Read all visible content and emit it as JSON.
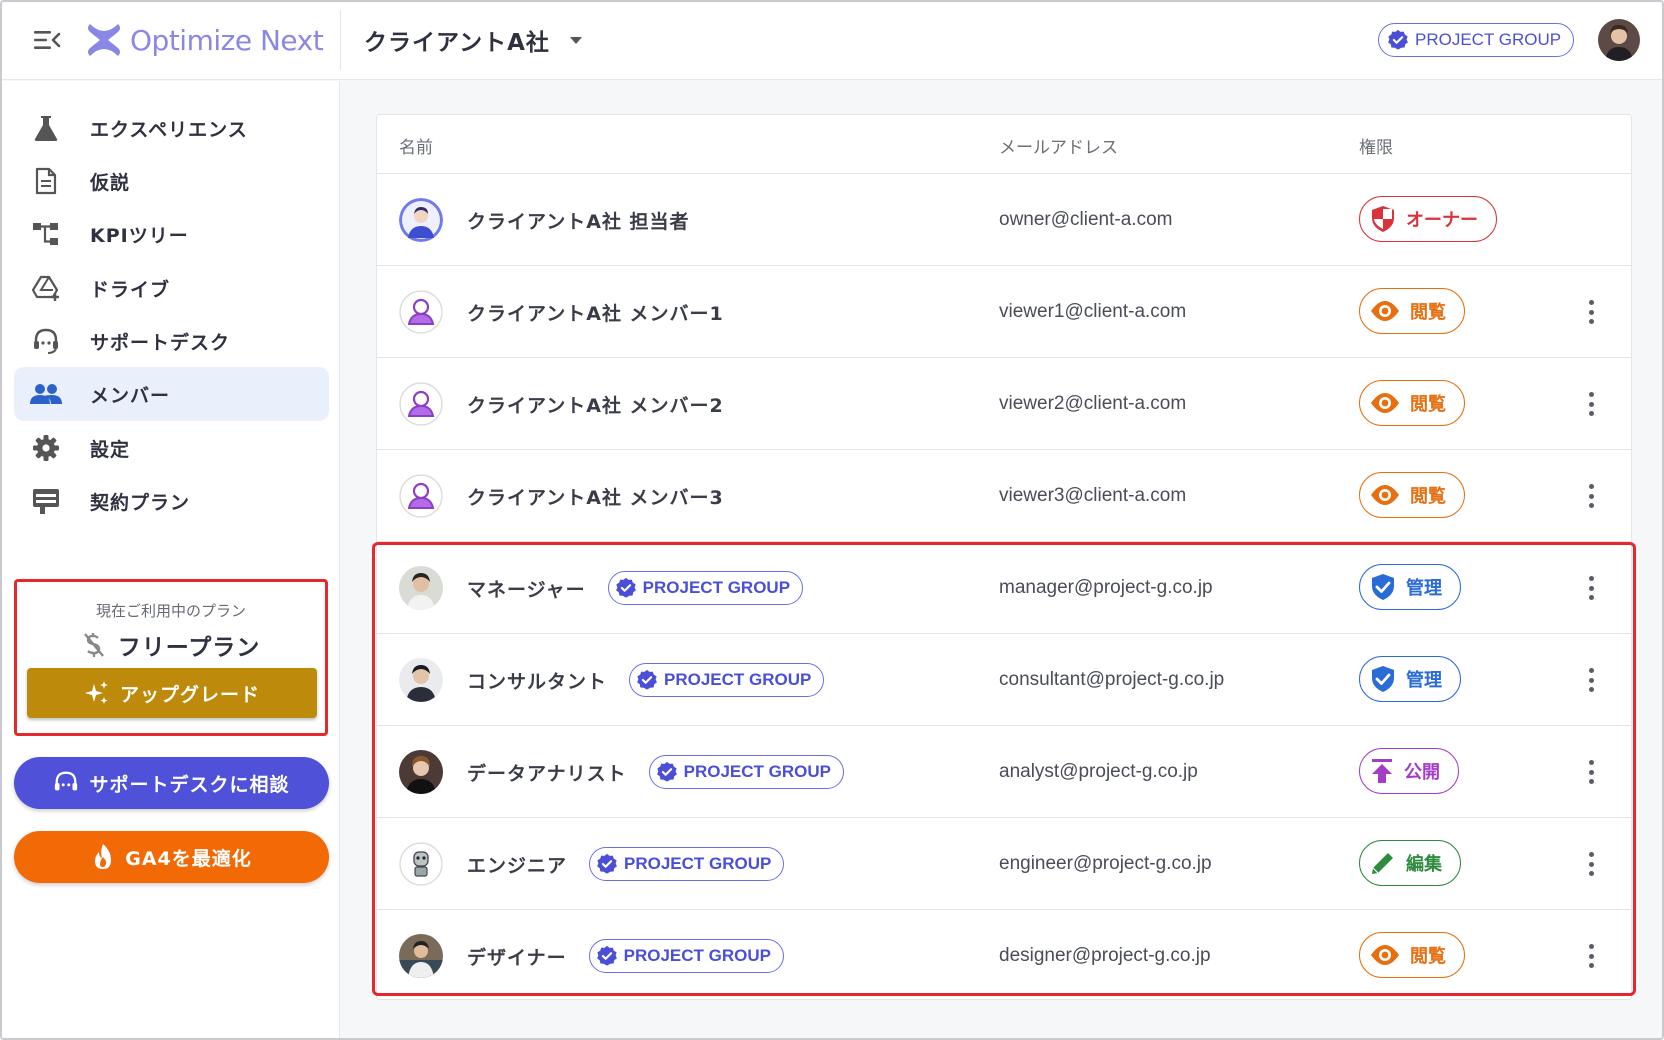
{
  "header": {
    "logo_text": "Optimize Next",
    "client_name": "クライアントA社",
    "group_badge": "PROJECT GROUP"
  },
  "sidebar": {
    "items": [
      {
        "label": "エクスペリエンス",
        "icon": "flask-icon"
      },
      {
        "label": "仮説",
        "icon": "document-icon"
      },
      {
        "label": "KPIツリー",
        "icon": "tree-icon"
      },
      {
        "label": "ドライブ",
        "icon": "drive-icon"
      },
      {
        "label": "サポートデスク",
        "icon": "headset-icon"
      },
      {
        "label": "メンバー",
        "icon": "people-icon",
        "active": true
      },
      {
        "label": "設定",
        "icon": "gear-icon"
      },
      {
        "label": "契約プラン",
        "icon": "plan-icon"
      }
    ],
    "plan": {
      "current_label": "現在ご利用中のプラン",
      "name": "フリープラン",
      "upgrade_label": "アップグレード"
    },
    "support_button": "サポートデスクに相談",
    "ga4_button": "GA4を最適化"
  },
  "table": {
    "headers": {
      "name": "名前",
      "email": "メールアドレス",
      "role": "権限"
    },
    "rows": [
      {
        "name": "クライアントA社 担当者",
        "email": "owner@client-a.com",
        "role": "オーナー",
        "role_type": "owner",
        "badge": ""
      },
      {
        "name": "クライアントA社 メンバー1",
        "email": "viewer1@client-a.com",
        "role": "閲覧",
        "role_type": "view",
        "badge": ""
      },
      {
        "name": "クライアントA社 メンバー2",
        "email": "viewer2@client-a.com",
        "role": "閲覧",
        "role_type": "view",
        "badge": ""
      },
      {
        "name": "クライアントA社 メンバー3",
        "email": "viewer3@client-a.com",
        "role": "閲覧",
        "role_type": "view",
        "badge": ""
      },
      {
        "name": "マネージャー",
        "email": "manager@project-g.co.jp",
        "role": "管理",
        "role_type": "admin",
        "badge": "PROJECT GROUP"
      },
      {
        "name": "コンサルタント",
        "email": "consultant@project-g.co.jp",
        "role": "管理",
        "role_type": "admin",
        "badge": "PROJECT GROUP"
      },
      {
        "name": "データアナリスト",
        "email": "analyst@project-g.co.jp",
        "role": "公開",
        "role_type": "publish",
        "badge": "PROJECT GROUP"
      },
      {
        "name": "エンジニア",
        "email": "engineer@project-g.co.jp",
        "role": "編集",
        "role_type": "edit",
        "badge": "PROJECT GROUP"
      },
      {
        "name": "デザイナー",
        "email": "designer@project-g.co.jp",
        "role": "閲覧",
        "role_type": "view",
        "badge": "PROJECT GROUP"
      }
    ]
  },
  "colors": {
    "accent": "#4f51d8",
    "upgrade": "#bd8a0b",
    "ga4": "#f16a06",
    "highlight": "#e5282e"
  }
}
